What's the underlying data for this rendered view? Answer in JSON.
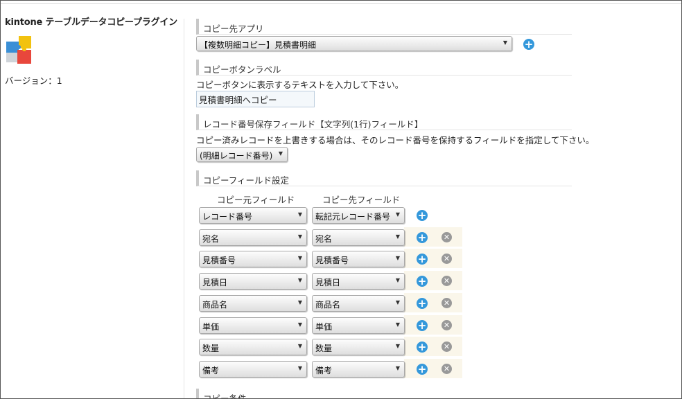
{
  "plugin": {
    "title": "kintone テーブルデータコピープラグイン",
    "version_label": "バージョン：1"
  },
  "sections": {
    "copy_app": {
      "label": "コピー先アプリ",
      "selected": "【複数明細コピー】見積書明細"
    },
    "button_label": {
      "label": "コピーボタンラベル",
      "description": "コピーボタンに表示するテキストを入力して下さい。",
      "value": "見積書明細へコピー"
    },
    "record_field": {
      "label": "レコード番号保存フィールド【文字列(1行)フィールド】",
      "description": "コピー済みレコードを上書きする場合は、そのレコード番号を保持するフィールドを指定して下さい。",
      "selected": "(明細レコード番号)"
    },
    "field_settings": {
      "label": "コピーフィールド設定",
      "source_header": "コピー元フィールド",
      "target_header": "コピー先フィールド",
      "rows": [
        {
          "source": "レコード番号",
          "target": "転記元レコード番号",
          "deletable": false
        },
        {
          "source": "宛名",
          "target": "宛名",
          "deletable": true
        },
        {
          "source": "見積番号",
          "target": "見積番号",
          "deletable": true
        },
        {
          "source": "見積日",
          "target": "見積日",
          "deletable": true
        },
        {
          "source": "商品名",
          "target": "商品名",
          "deletable": true
        },
        {
          "source": "単価",
          "target": "単価",
          "deletable": true
        },
        {
          "source": "数量",
          "target": "数量",
          "deletable": true
        },
        {
          "source": "備考",
          "target": "備考",
          "deletable": true
        }
      ]
    },
    "conditions": {
      "label": "コピー条件"
    }
  },
  "icons": {
    "add": "plus-circle-icon",
    "remove": "x-circle-icon",
    "dropdown": "triangle-down-icon"
  },
  "colors": {
    "add_button": "#3498db",
    "remove_button": "#999999",
    "row_highlight": "#faf6ea"
  }
}
